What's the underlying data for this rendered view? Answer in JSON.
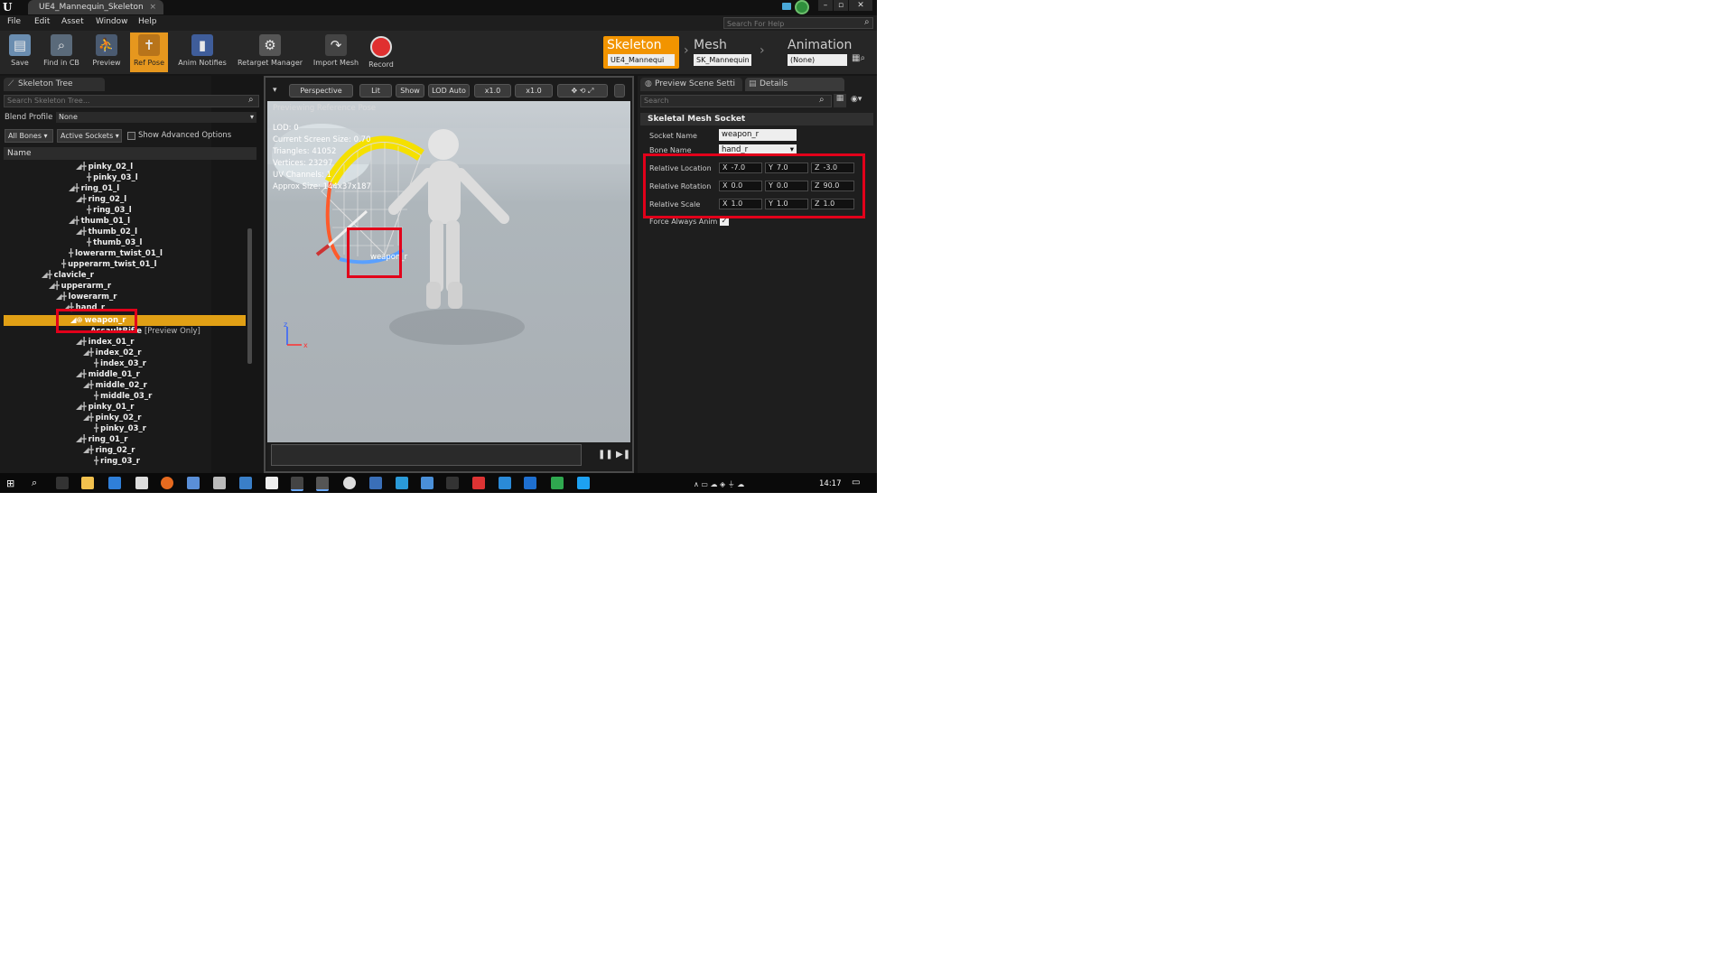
{
  "window": {
    "document_tab": "UE4_Mannequin_Skeleton",
    "help_search_placeholder": "Search For Help"
  },
  "menu": [
    "File",
    "Edit",
    "Asset",
    "Window",
    "Help"
  ],
  "toolbar": {
    "save": "Save",
    "find_in_cb": "Find in CB",
    "preview": "Preview",
    "ref_pose": "Ref Pose",
    "anim_notifies": "Anim Notifies",
    "retarget_manager": "Retarget Manager",
    "import_mesh": "Import Mesh",
    "record": "Record"
  },
  "asset_nav": {
    "skeleton_label": "Skeleton",
    "skeleton_value": "UE4_Mannequi",
    "mesh_label": "Mesh",
    "mesh_value": "SK_Mannequin",
    "animation_label": "Animation",
    "animation_value": "(None)"
  },
  "skeleton_tree": {
    "tab": "Skeleton Tree",
    "search_placeholder": "Search Skeleton Tree...",
    "blend_profile_label": "Blend Profile",
    "blend_profile_value": "None",
    "bones_filter": "All Bones",
    "sockets_filter": "Active Sockets",
    "show_advanced": "Show Advanced Options",
    "column_name": "Name",
    "rows": [
      {
        "name": "pinky_02_l"
      },
      {
        "name": "pinky_03_l"
      },
      {
        "name": "ring_01_l"
      },
      {
        "name": "ring_02_l"
      },
      {
        "name": "ring_03_l"
      },
      {
        "name": "thumb_01_l"
      },
      {
        "name": "thumb_02_l"
      },
      {
        "name": "thumb_03_l"
      },
      {
        "name": "lowerarm_twist_01_l"
      },
      {
        "name": "upperarm_twist_01_l"
      },
      {
        "name": "clavicle_r"
      },
      {
        "name": "upperarm_r"
      },
      {
        "name": "lowerarm_r"
      },
      {
        "name": "hand_r"
      },
      {
        "name": "weapon_r"
      },
      {
        "name": "AssaultRifle",
        "suffix": "[Preview Only]"
      },
      {
        "name": "index_01_r"
      },
      {
        "name": "index_02_r"
      },
      {
        "name": "index_03_r"
      },
      {
        "name": "middle_01_r"
      },
      {
        "name": "middle_02_r"
      },
      {
        "name": "middle_03_r"
      },
      {
        "name": "pinky_01_r"
      },
      {
        "name": "pinky_02_r"
      },
      {
        "name": "pinky_03_r"
      },
      {
        "name": "ring_01_r"
      },
      {
        "name": "ring_02_r"
      },
      {
        "name": "ring_03_r"
      }
    ]
  },
  "viewport": {
    "perspective": "Perspective",
    "lit": "Lit",
    "show": "Show",
    "lod": "LOD Auto",
    "speed1": "x1.0",
    "speed2": "x1.0",
    "previewing": "Previewing Reference Pose",
    "stats": [
      "LOD: 0",
      "Current Screen Size: 0.70",
      "Triangles: 41052",
      "Vertices: 23297",
      "UV Channels: 1",
      "Approx Size: 144x37x187"
    ],
    "socket_label": "weapon_r"
  },
  "details": {
    "tab_preview": "Preview Scene Setti",
    "tab_details": "Details",
    "search_placeholder": "Search",
    "section": "Skeletal Mesh Socket",
    "socket_name_label": "Socket Name",
    "socket_name_value": "weapon_r",
    "bone_name_label": "Bone Name",
    "bone_name_value": "hand_r",
    "relative_location_label": "Relative Location",
    "relative_location": {
      "x": "-7.0",
      "y": "7.0",
      "z": "-3.0"
    },
    "relative_rotation_label": "Relative Rotation",
    "relative_rotation": {
      "x": "0.0",
      "y": "0.0",
      "z": "90.0"
    },
    "relative_scale_label": "Relative Scale",
    "relative_scale": {
      "x": "1.0",
      "y": "1.0",
      "z": "1.0"
    },
    "force_always_anim_label": "Force Always Anim"
  },
  "taskbar": {
    "clock": "14:17"
  },
  "colors": {
    "accent_orange": "#f29400",
    "selection": "#e1a015",
    "highlight_red": "#e2001a"
  }
}
